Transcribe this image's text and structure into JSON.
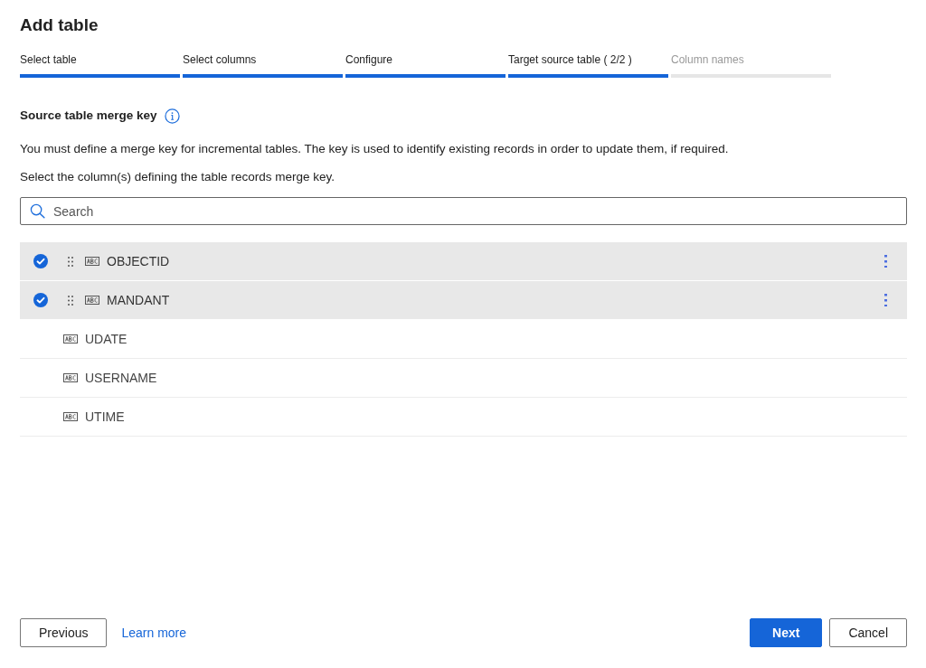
{
  "title": "Add table",
  "steps": [
    {
      "label": "Select table",
      "completed": true
    },
    {
      "label": "Select columns",
      "completed": true
    },
    {
      "label": "Configure",
      "completed": true
    },
    {
      "label": "Target source table ( 2/2 )",
      "completed": true
    },
    {
      "label": "Column names",
      "completed": false
    }
  ],
  "section": {
    "heading": "Source table merge key",
    "description": "You must define a merge key for incremental tables. The key is used to identify existing records in order to update them, if required.",
    "instruction": "Select the column(s) defining the table records merge key."
  },
  "search": {
    "placeholder": "Search"
  },
  "columns": [
    {
      "name": "OBJECTID",
      "selected": true
    },
    {
      "name": "MANDANT",
      "selected": true
    },
    {
      "name": "UDATE",
      "selected": false
    },
    {
      "name": "USERNAME",
      "selected": false
    },
    {
      "name": "UTIME",
      "selected": false
    }
  ],
  "footer": {
    "previous": "Previous",
    "link": "Learn more",
    "next": "Next",
    "cancel": "Cancel"
  }
}
